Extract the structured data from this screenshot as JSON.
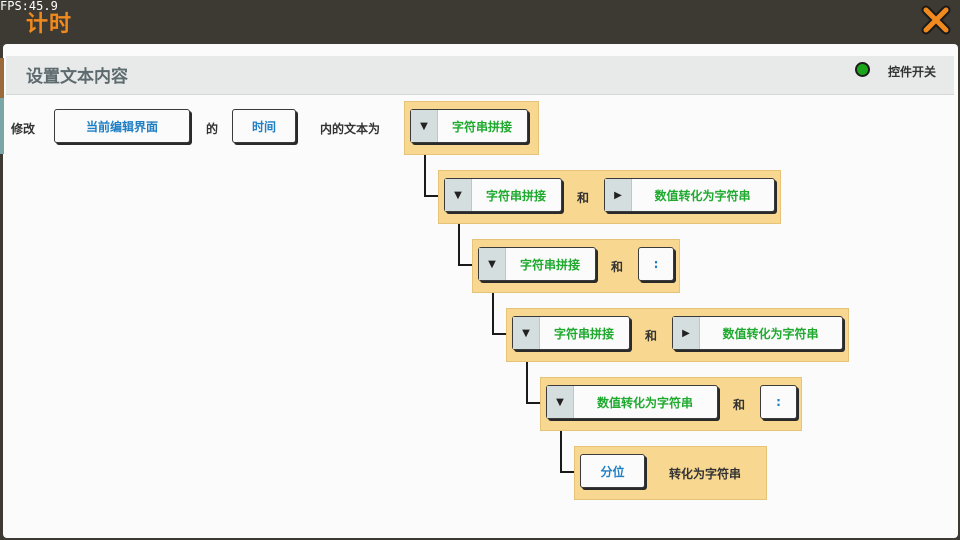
{
  "window": {
    "fps": "FPS:45.9",
    "title": "计时",
    "close_icon": "close-x-icon",
    "accent_color": "#f08a1e"
  },
  "header": {
    "title": "设置文本内容",
    "switch_label": "控件开关",
    "switch_on": true,
    "switch_color": "#1aa61a"
  },
  "statement": {
    "modify": "修改",
    "ui_value": "当前编辑界面",
    "of": "的",
    "element_value": "时间",
    "text_is": "内的文本为"
  },
  "blocks": {
    "b1": {
      "label": "字符串拼接"
    },
    "b2": {
      "label": "字符串拼接",
      "and": "和",
      "right": "数值转化为字符串"
    },
    "b3": {
      "label": "字符串拼接",
      "and": "和",
      "right": ":"
    },
    "b4": {
      "label": "字符串拼接",
      "and": "和",
      "right": "数值转化为字符串"
    },
    "b5": {
      "label": "数值转化为字符串",
      "and": "和",
      "right": ":"
    },
    "b6": {
      "value": "分位",
      "suffix": "转化为字符串"
    }
  },
  "colors": {
    "block_fill": "#f8d891",
    "function_text": "#1faa2f",
    "value_text": "#1f7fc4"
  }
}
